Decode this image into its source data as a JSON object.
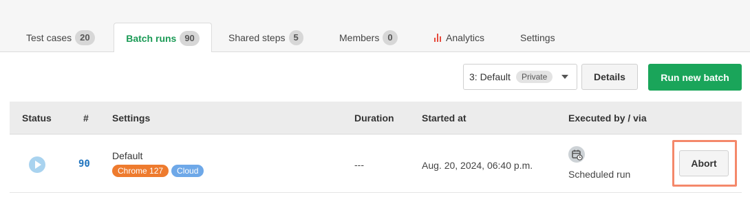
{
  "tabs": [
    {
      "label": "Test cases",
      "count": "20"
    },
    {
      "label": "Batch runs",
      "count": "90",
      "active": true
    },
    {
      "label": "Shared steps",
      "count": "5"
    },
    {
      "label": "Members",
      "count": "0"
    },
    {
      "label": "Analytics",
      "icon": "bar-chart-icon"
    },
    {
      "label": "Settings"
    }
  ],
  "toolbar": {
    "environment_value": "3: Default",
    "environment_badge": "Private",
    "details_label": "Details",
    "run_label": "Run new batch"
  },
  "table": {
    "headers": [
      "Status",
      "#",
      "Settings",
      "Duration",
      "Started at",
      "Executed by / via"
    ],
    "rows": [
      {
        "status_icon": "play-icon",
        "number": "90",
        "setting_name": "Default",
        "tags": [
          "Chrome 127",
          "Cloud"
        ],
        "duration": "---",
        "started_at": "Aug. 20, 2024, 06:40 p.m.",
        "executed_icon": "scheduled-calendar-icon",
        "executed_via": "Scheduled run",
        "action_label": "Abort"
      }
    ]
  },
  "colors": {
    "accent": "#1aa55a",
    "link": "#1e73be",
    "chrome_tag": "#ee7b2e",
    "cloud_tag": "#6ea8e8",
    "highlight": "#f4886a"
  }
}
